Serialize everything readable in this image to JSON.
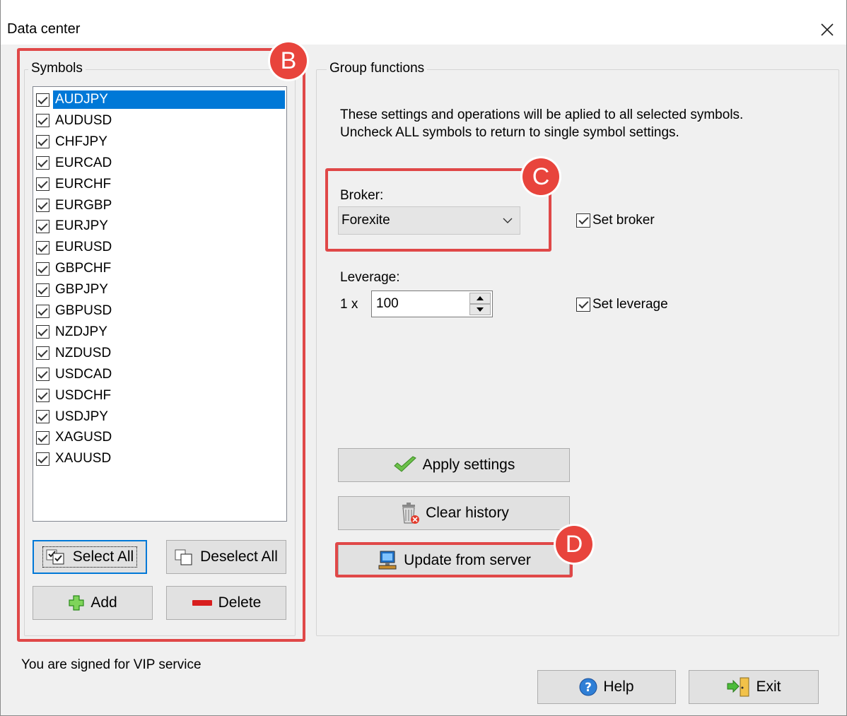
{
  "window": {
    "title": "Data center"
  },
  "symbols": {
    "legend": "Symbols",
    "items": [
      {
        "label": "AUDJPY",
        "checked": true,
        "selected": true
      },
      {
        "label": "AUDUSD",
        "checked": true
      },
      {
        "label": "CHFJPY",
        "checked": true
      },
      {
        "label": "EURCAD",
        "checked": true
      },
      {
        "label": "EURCHF",
        "checked": true
      },
      {
        "label": "EURGBP",
        "checked": true
      },
      {
        "label": "EURJPY",
        "checked": true
      },
      {
        "label": "EURUSD",
        "checked": true
      },
      {
        "label": "GBPCHF",
        "checked": true
      },
      {
        "label": "GBPJPY",
        "checked": true
      },
      {
        "label": "GBPUSD",
        "checked": true
      },
      {
        "label": "NZDJPY",
        "checked": true
      },
      {
        "label": "NZDUSD",
        "checked": true
      },
      {
        "label": "USDCAD",
        "checked": true
      },
      {
        "label": "USDCHF",
        "checked": true
      },
      {
        "label": "USDJPY",
        "checked": true
      },
      {
        "label": "XAGUSD",
        "checked": true
      },
      {
        "label": "XAUUSD",
        "checked": true
      }
    ],
    "select_all_label": "Select All",
    "deselect_all_label": "Deselect All",
    "add_label": "Add",
    "delete_label": "Delete"
  },
  "group": {
    "legend": "Group functions",
    "description_line1": "These settings and operations will be aplied to all selected symbols.",
    "description_line2": "Uncheck ALL symbols to return to single symbol settings.",
    "broker_label": "Broker:",
    "broker_value": "Forexite",
    "set_broker_label": "Set broker",
    "leverage_label": "Leverage:",
    "leverage_prefix": "1 x",
    "leverage_value": "100",
    "set_leverage_label": "Set leverage",
    "apply_label": "Apply settings",
    "clear_label": "Clear history",
    "update_label": "Update from server"
  },
  "footer": {
    "status": "You are signed for VIP service",
    "help_label": "Help",
    "exit_label": "Exit"
  },
  "callouts": {
    "b": "B",
    "c": "C",
    "d": "D"
  },
  "colors": {
    "accent": "#0078d7",
    "callout": "#e8443c"
  }
}
